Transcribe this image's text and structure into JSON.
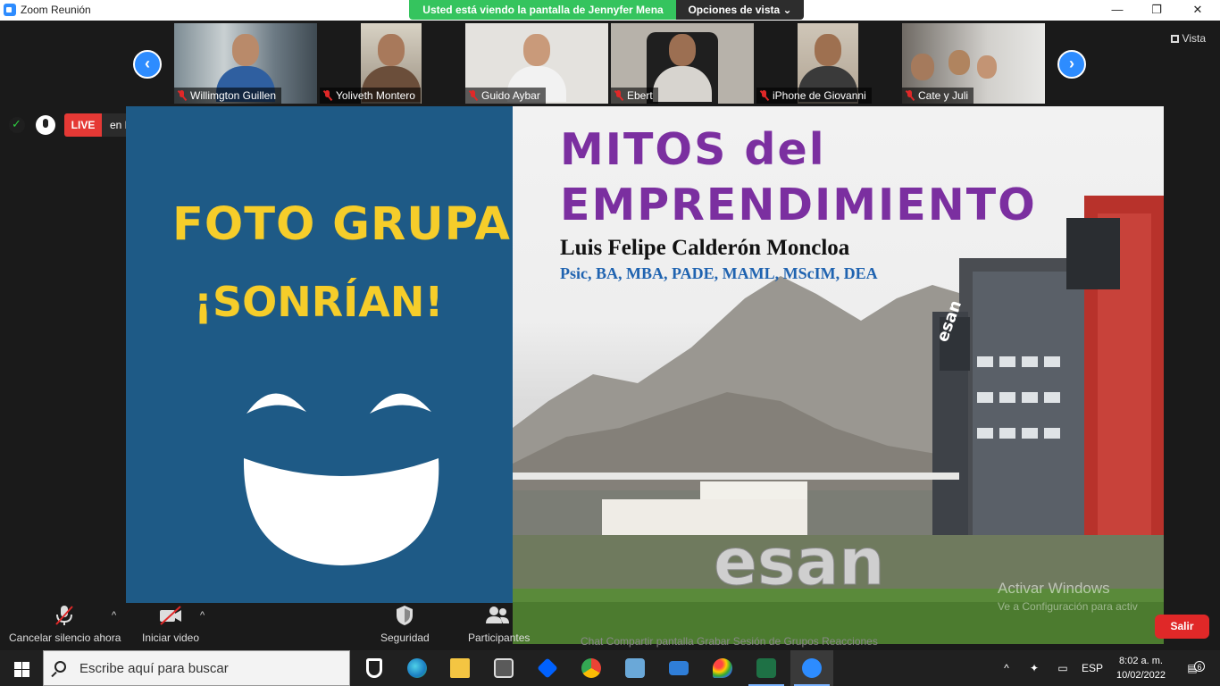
{
  "window": {
    "title": "Zoom Reunión",
    "controls": {
      "minimize": "—",
      "maximize": "❐",
      "close": "✕"
    }
  },
  "share": {
    "banner": "Usted está viendo la pantalla de Jennyfer Mena",
    "view_options": "Opciones de vista ⌄"
  },
  "view_toggle": "Vista",
  "participants": [
    {
      "name": "Willimgton Guillen",
      "muted": true
    },
    {
      "name": "Yoliveth Montero",
      "muted": true
    },
    {
      "name": "Guido Aybar",
      "muted": true
    },
    {
      "name": "Ebert",
      "muted": true
    },
    {
      "name": "iPhone de Giovanni",
      "muted": true
    },
    {
      "name": "Cate y Juli",
      "muted": true
    }
  ],
  "nav": {
    "prev": "‹",
    "next": "›"
  },
  "live": {
    "tag": "LIVE",
    "destination": "en Facebook ▾"
  },
  "slide": {
    "left_line1": "FOTO GRUPAL",
    "left_line2": "¡SONRÍAN!",
    "title_line1": "MITOS del",
    "title_line2": "EMPRENDIMIENTO",
    "author": "Luis Felipe Calderón Moncloa",
    "degrees": "Psic, BA, MBA, PADE, MAML, MScIM, DEA",
    "building_sign": "esan",
    "watermark_line1": "Activar Windows",
    "watermark_line2": "Ve a Configuración para activ"
  },
  "toolbar": {
    "mute": "Cancelar silencio ahora",
    "video": "Iniciar video",
    "security": "Seguridad",
    "participants": "Participantes",
    "leave": "Salir",
    "overlapped": "Chat        Compartir pantalla        Grabar        Sesión de Grupos        Reacciones"
  },
  "taskbar": {
    "search_placeholder": "Escribe aquí para buscar",
    "language": "ESP",
    "time": "8:02 a. m.",
    "date": "10/02/2022",
    "notifications": "6"
  },
  "colors": {
    "zoom_blue": "#2d8cff",
    "share_green": "#35c45e",
    "slide_blue": "#1e5a86",
    "slide_yellow": "#f6cd2a",
    "title_purple": "#7b2fa0",
    "leave_red": "#e02828"
  }
}
